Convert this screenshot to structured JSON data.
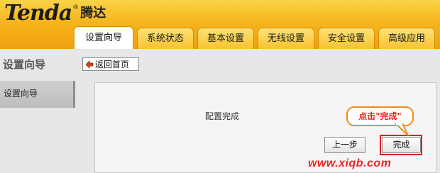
{
  "header": {
    "logo_text": "Tenda",
    "logo_reg": "®",
    "logo_cn": "腾达",
    "tabs": [
      {
        "label": "设置向导",
        "active": true
      },
      {
        "label": "系统状态",
        "active": false
      },
      {
        "label": "基本设置",
        "active": false
      },
      {
        "label": "无线设置",
        "active": false
      },
      {
        "label": "安全设置",
        "active": false
      },
      {
        "label": "高级应用",
        "active": false
      }
    ]
  },
  "page": {
    "title": "设置向导",
    "back_button_label": "返回首页"
  },
  "sidebar": {
    "items": [
      {
        "label": "设置向导",
        "active": true
      }
    ]
  },
  "content": {
    "message": "配置完成",
    "prev_button_label": "上一步",
    "finish_button_label": "完成"
  },
  "annotation": {
    "callout_text": "点击\"完成\""
  },
  "watermark": "www.xiqb.com",
  "colors": {
    "header_orange": "#f6b51c",
    "highlight_red": "#e02020",
    "callout_border": "#f28c1a"
  }
}
